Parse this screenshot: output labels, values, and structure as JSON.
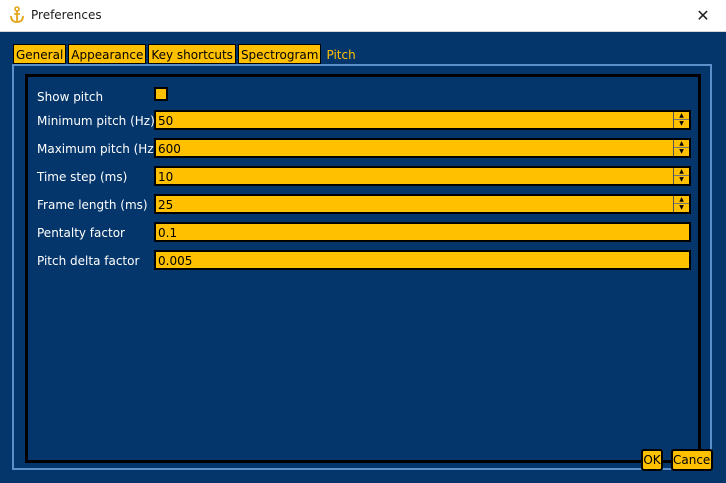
{
  "window": {
    "title": "Preferences"
  },
  "tabs": [
    {
      "label": "General"
    },
    {
      "label": "Appearance"
    },
    {
      "label": "Key shortcuts"
    },
    {
      "label": "Spectrogram"
    },
    {
      "label": "Pitch"
    }
  ],
  "pitch": {
    "show_pitch_label": "Show pitch",
    "fields": [
      {
        "label": "Minimum pitch (Hz)",
        "value": "50"
      },
      {
        "label": "Maximum pitch (Hz)",
        "value": "600"
      },
      {
        "label": "Time step (ms)",
        "value": "10"
      },
      {
        "label": "Frame length (ms)",
        "value": "25"
      },
      {
        "label": "Pentalty factor",
        "value": "0.1"
      },
      {
        "label": "Pitch delta factor",
        "value": "0.005"
      }
    ]
  },
  "buttons": {
    "ok": "OK",
    "cancel": "Cancel"
  },
  "icons": {
    "app": "anchor-icon",
    "close": "close-icon",
    "spin_up": "chevron-up-icon",
    "spin_down": "chevron-down-icon"
  },
  "colors": {
    "background": "#04366b",
    "accent": "#ffc000"
  }
}
